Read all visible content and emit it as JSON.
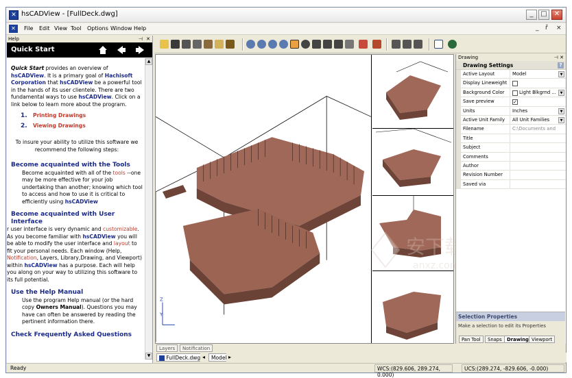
{
  "window": {
    "title": "hsCADView - [FullDeck.dwg]",
    "icon": "hsCADView-app-icon"
  },
  "menu": {
    "items": [
      "File",
      "Edit",
      "View",
      "Tool",
      "Options",
      "Window",
      "Help"
    ],
    "mdi_controls": [
      "_",
      "ř",
      "×"
    ]
  },
  "help_panel": {
    "header": "Help",
    "title": "Quick Start",
    "intro_lead": "Quick Start",
    "intro_text1": " provides an overview of ",
    "brand": "hsCADView",
    "intro_text2": ". It is a primary goal of ",
    "company": "Hachisoft Corporation",
    "intro_text3": " that ",
    "intro_text4": " be a powerful tool in the hands of its user clientele. There are two fundamental ways to use ",
    "intro_text5": ". Click on a link below to learn more about the program.",
    "links": [
      {
        "num": "1.",
        "label": "Printing Drawings"
      },
      {
        "num": "2.",
        "label": "Viewing Drawings"
      }
    ],
    "recommend": "To insure your ability to utilize this software we recommend the following steps:",
    "sections": [
      {
        "title": "Become acquainted with the Tools"
      },
      {
        "title": "Become acquainted with User Interface"
      },
      {
        "title": "Use the Help Manual"
      },
      {
        "title": "Check Frequently Asked Questions"
      }
    ],
    "tools_p1": "Become acquainted with all of the ",
    "tools_hl": "tools",
    "tools_p2": " --one may be more effective for your job undertaking than another; knowing which tool to access and how to use it is critical to efficiently using ",
    "ui_p1": "r user interface is very dynamic and ",
    "ui_hl1": "customizable",
    "ui_p2": ". As you become familiar with ",
    "ui_p3": " you will be able to modify the user interface and ",
    "ui_hl2": "layout",
    "ui_p4": " to fit your personal needs. Each window (Help, ",
    "ui_hl3": "Notification",
    "ui_p5": ", Layers, Library,Drawing, and Viewport) within ",
    "ui_p6": " has a purpose. Each will help you along on your way to utilizing this software to its full potential.",
    "manual_p1": "Use the program Help manual (or the hard copy ",
    "manual_bold": "Owners Manual",
    "manual_p2": "). Questions you may have can often be answered by reading the pertinent information there."
  },
  "viewport": {
    "tabs": [
      "Layers",
      "Notification"
    ],
    "doc_tabs": [
      "FullDeck.dwg",
      "Model"
    ],
    "axis": {
      "z": "Z",
      "y": "Y"
    }
  },
  "drawing_panel": {
    "header": "Drawing",
    "section": "Drawing Settings",
    "properties": [
      {
        "name": "Active Layout",
        "value": "Model",
        "type": "dropdown"
      },
      {
        "name": "Display Lineweight",
        "value": "",
        "type": "checkbox",
        "checked": false
      },
      {
        "name": "Background Color",
        "value": "Light Blkgrnd ...",
        "type": "color-dropdown"
      },
      {
        "name": "Save preview",
        "value": "",
        "type": "checkbox",
        "checked": true
      },
      {
        "name": "Units",
        "value": "Inches",
        "type": "dropdown"
      },
      {
        "name": "Active Unit Family",
        "value": "All Unit Families",
        "type": "dropdown"
      },
      {
        "name": "Filename",
        "value": "C:\\Documents and",
        "type": "readonly"
      },
      {
        "name": "Title",
        "value": "",
        "type": "text"
      },
      {
        "name": "Subject",
        "value": "",
        "type": "text"
      },
      {
        "name": "Comments",
        "value": "",
        "type": "text"
      },
      {
        "name": "Author",
        "value": "",
        "type": "text"
      },
      {
        "name": "Revision Number",
        "value": "",
        "type": "text"
      },
      {
        "name": "Saved via",
        "value": "",
        "type": "text"
      }
    ],
    "selection_title": "Selection Properties",
    "selection_desc": "Make a selection to edit its Properties",
    "tabs": [
      "Pan Tool",
      "Snaps",
      "Drawing",
      "Viewport"
    ],
    "active_tab": "Drawing"
  },
  "status": {
    "ready": "Ready",
    "wcs": "WCS:(829.606, 289.274, 0.000)",
    "ucs": "UCS:(289.274, -829.606, -0.000)"
  },
  "colors": {
    "deck_brown": "#8a5a4a",
    "brand_blue": "#1a2a8a",
    "link_red": "#c0392b"
  }
}
